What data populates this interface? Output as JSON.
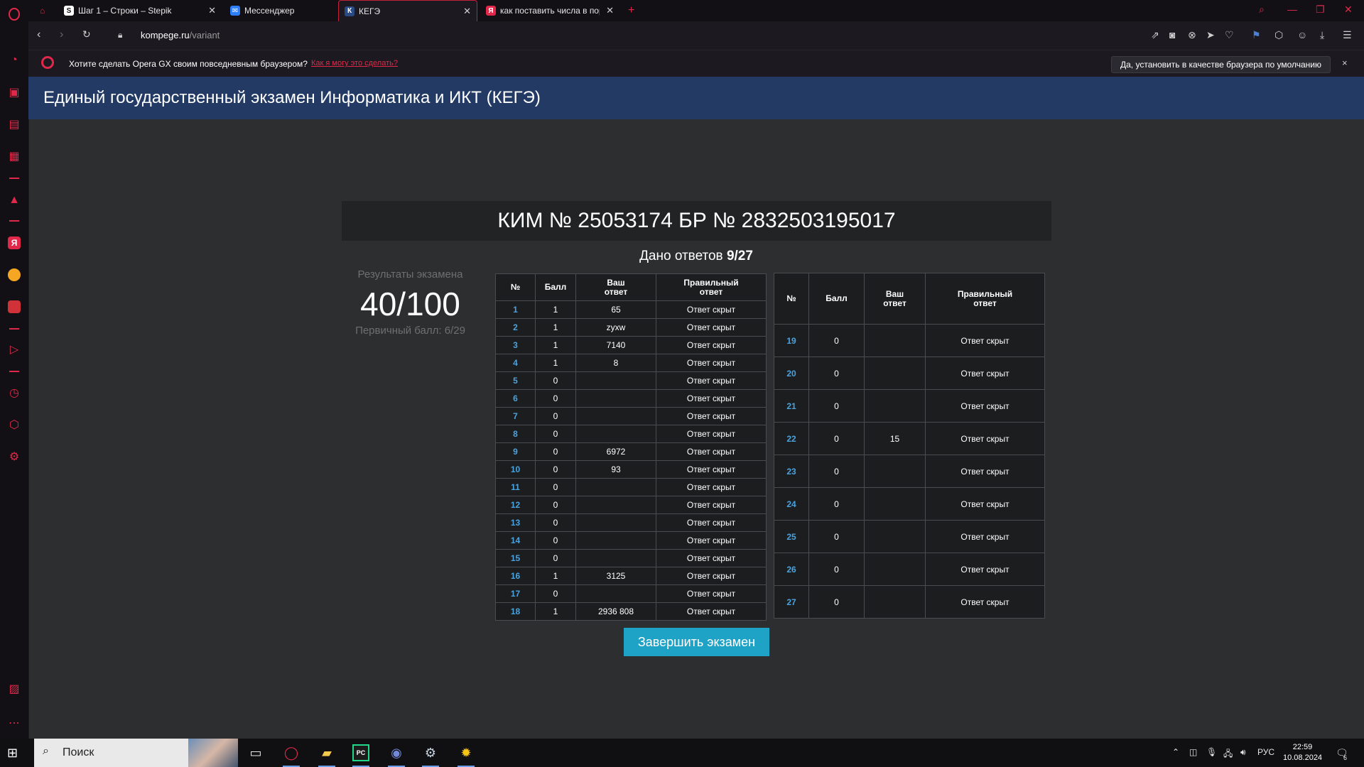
{
  "browser": {
    "tabs": [
      {
        "label": "Шаг 1 – Строки – Stepik",
        "favicon": "stepik-icon",
        "active": false
      },
      {
        "label": "Мессенджер",
        "favicon": "messenger-icon",
        "active": false
      },
      {
        "label": "КЕГЭ",
        "favicon": "kege-icon",
        "active": true
      },
      {
        "label": "как поставить числа в пор",
        "favicon": "yandex-icon",
        "active": false
      }
    ],
    "new_tab": "+",
    "url_host": "kompege.ru",
    "url_path": "/variant",
    "notice": {
      "text": "Хотите сделать Opera GX своим повседневным браузером?",
      "link": "Как я могу это сделать?",
      "button": "Да, установить в качестве браузера по умолчанию",
      "close": "×"
    }
  },
  "page": {
    "title": "Единый государственный экзамен Информатика и ИКТ (КЕГЭ)",
    "kim": "КИМ № 25053174 БР № 2832503195017",
    "results": {
      "label": "Результаты экзамена",
      "score": "40/100",
      "primary": "Первичный балл: 6/29"
    },
    "answers_given_label": "Дано ответов",
    "answers_given_value": "9/27",
    "headers": {
      "num": "№",
      "score": "Балл",
      "your_answer": "Ваш ответ",
      "correct_answer": "Правильный ответ"
    },
    "rows_left": [
      {
        "num": "1",
        "score": "1",
        "answer": "65",
        "correct": "Ответ скрыт"
      },
      {
        "num": "2",
        "score": "1",
        "answer": "zyxw",
        "correct": "Ответ скрыт"
      },
      {
        "num": "3",
        "score": "1",
        "answer": "7140",
        "correct": "Ответ скрыт"
      },
      {
        "num": "4",
        "score": "1",
        "answer": "8",
        "correct": "Ответ скрыт"
      },
      {
        "num": "5",
        "score": "0",
        "answer": "",
        "correct": "Ответ скрыт"
      },
      {
        "num": "6",
        "score": "0",
        "answer": "",
        "correct": "Ответ скрыт"
      },
      {
        "num": "7",
        "score": "0",
        "answer": "",
        "correct": "Ответ скрыт"
      },
      {
        "num": "8",
        "score": "0",
        "answer": "",
        "correct": "Ответ скрыт"
      },
      {
        "num": "9",
        "score": "0",
        "answer": "6972",
        "correct": "Ответ скрыт"
      },
      {
        "num": "10",
        "score": "0",
        "answer": "93",
        "correct": "Ответ скрыт"
      },
      {
        "num": "11",
        "score": "0",
        "answer": "",
        "correct": "Ответ скрыт"
      },
      {
        "num": "12",
        "score": "0",
        "answer": "",
        "correct": "Ответ скрыт"
      },
      {
        "num": "13",
        "score": "0",
        "answer": "",
        "correct": "Ответ скрыт"
      },
      {
        "num": "14",
        "score": "0",
        "answer": "",
        "correct": "Ответ скрыт"
      },
      {
        "num": "15",
        "score": "0",
        "answer": "",
        "correct": "Ответ скрыт"
      },
      {
        "num": "16",
        "score": "1",
        "answer": "3125",
        "correct": "Ответ скрыт"
      },
      {
        "num": "17",
        "score": "0",
        "answer": "",
        "correct": "Ответ скрыт"
      },
      {
        "num": "18",
        "score": "1",
        "answer": "2936 808",
        "correct": "Ответ скрыт"
      }
    ],
    "rows_right": [
      {
        "num": "19",
        "score": "0",
        "answer": "",
        "correct": "Ответ скрыт"
      },
      {
        "num": "20",
        "score": "0",
        "answer": "",
        "correct": "Ответ скрыт"
      },
      {
        "num": "21",
        "score": "0",
        "answer": "",
        "correct": "Ответ скрыт"
      },
      {
        "num": "22",
        "score": "0",
        "answer": "15",
        "correct": "Ответ скрыт"
      },
      {
        "num": "23",
        "score": "0",
        "answer": "",
        "correct": "Ответ скрыт"
      },
      {
        "num": "24",
        "score": "0",
        "answer": "",
        "correct": "Ответ скрыт"
      },
      {
        "num": "25",
        "score": "0",
        "answer": "",
        "correct": "Ответ скрыт"
      },
      {
        "num": "26",
        "score": "0",
        "answer": "",
        "correct": "Ответ скрыт"
      },
      {
        "num": "27",
        "score": "0",
        "answer": "",
        "correct": "Ответ скрыт"
      }
    ],
    "finish_button": "Завершить экзамен"
  },
  "taskbar": {
    "search_placeholder": "Поиск",
    "language": "РУС",
    "time": "22:59",
    "date": "10.08.2024",
    "notification_count": "6"
  },
  "colors": {
    "accent_red": "#e0294a",
    "header_blue": "#223a64",
    "link_blue": "#4aa3df",
    "button_teal": "#1ea3c7"
  }
}
